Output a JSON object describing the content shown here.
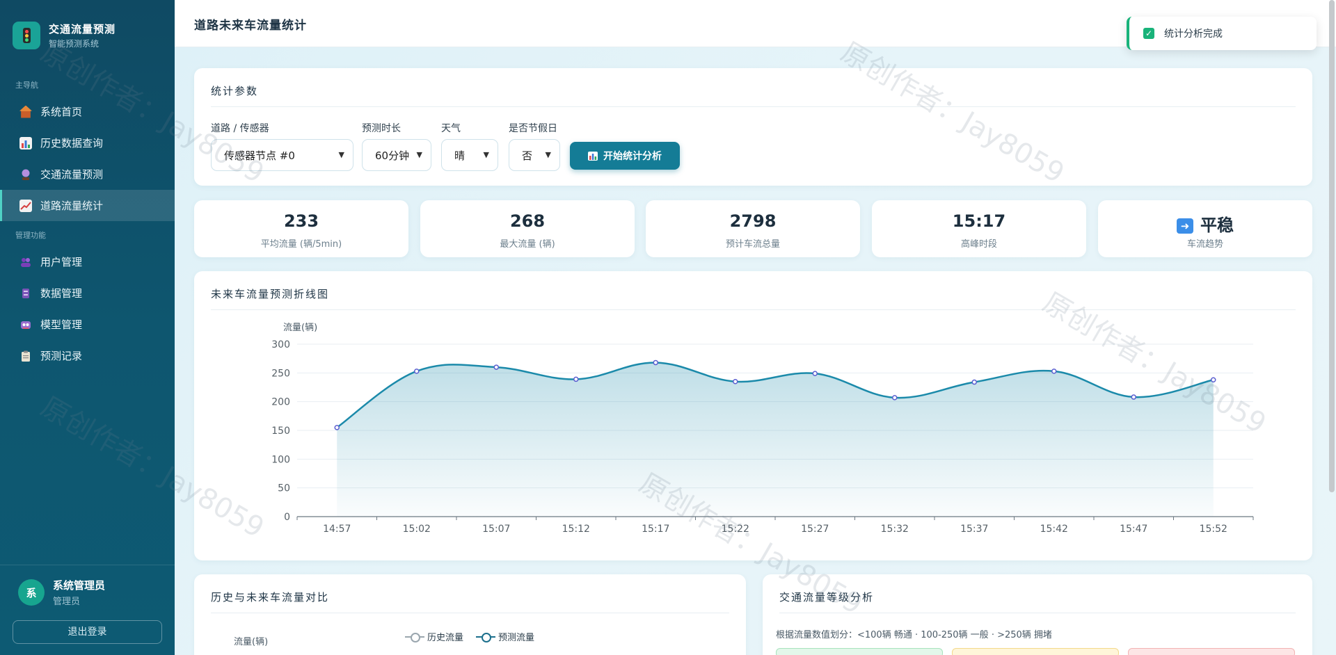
{
  "app": {
    "title": "交通流量预测",
    "subtitle": "智能预测系统"
  },
  "sidebar": {
    "section_main": "主导航",
    "section_manage": "管理功能",
    "items": [
      {
        "label": "系统首页",
        "icon": "home-icon"
      },
      {
        "label": "历史数据查询",
        "icon": "bar-chart-icon"
      },
      {
        "label": "交通流量预测",
        "icon": "crystal-ball-icon"
      },
      {
        "label": "道路流量统计",
        "icon": "line-chart-icon",
        "active": true
      },
      {
        "label": "用户管理",
        "icon": "users-icon"
      },
      {
        "label": "数据管理",
        "icon": "database-icon"
      },
      {
        "label": "模型管理",
        "icon": "robot-icon"
      },
      {
        "label": "预测记录",
        "icon": "clipboard-icon"
      }
    ],
    "user": {
      "avatar": "系",
      "name": "系统管理员",
      "role": "管理员"
    },
    "logout": "退出登录"
  },
  "header": {
    "title": "道路未来车流量统计"
  },
  "toast": {
    "text": "统计分析完成"
  },
  "params": {
    "title": "统计参数",
    "road_label": "道路 / 传感器",
    "road_value": "传感器节点 #0",
    "duration_label": "预测时长",
    "duration_value": "60分钟",
    "weather_label": "天气",
    "weather_value": "晴",
    "holiday_label": "是否节假日",
    "holiday_value": "否",
    "button": "开始统计分析"
  },
  "stats": [
    {
      "value": "233",
      "label": "平均流量 (辆/5min)"
    },
    {
      "value": "268",
      "label": "最大流量 (辆)"
    },
    {
      "value": "2798",
      "label": "预计车流总量"
    },
    {
      "value": "15:17",
      "label": "高峰时段"
    },
    {
      "value": "平稳",
      "label": "车流趋势"
    }
  ],
  "chart_card": {
    "title": "未来车流量预测折线图"
  },
  "chart_data": {
    "type": "area",
    "ylabel": "流量(辆)",
    "ylim": [
      0,
      300
    ],
    "yticks": [
      "300",
      "250",
      "200",
      "150",
      "100",
      "50",
      "0"
    ],
    "categories": [
      "14:57",
      "15:02",
      "15:07",
      "15:12",
      "15:17",
      "15:22",
      "15:27",
      "15:32",
      "15:37",
      "15:42",
      "15:47",
      "15:52"
    ],
    "values": [
      155,
      253,
      260,
      239,
      268,
      235,
      249,
      207,
      234,
      253,
      208,
      238
    ],
    "line_color": "#1b8aaa"
  },
  "compare_card": {
    "title": "历史与未来车流量对比",
    "ylabel": "流量(辆)",
    "legend_hist": "历史流量",
    "legend_pred": "预测流量"
  },
  "level_card": {
    "title": "交通流量等级分析",
    "desc": "根据流量数值划分：<100辆 畅通 · 100-250辆 一般 · >250辆 拥堵"
  },
  "colors": {
    "accent": "#147c96",
    "sidebar": "#0f4a63",
    "success": "#19b37a"
  }
}
